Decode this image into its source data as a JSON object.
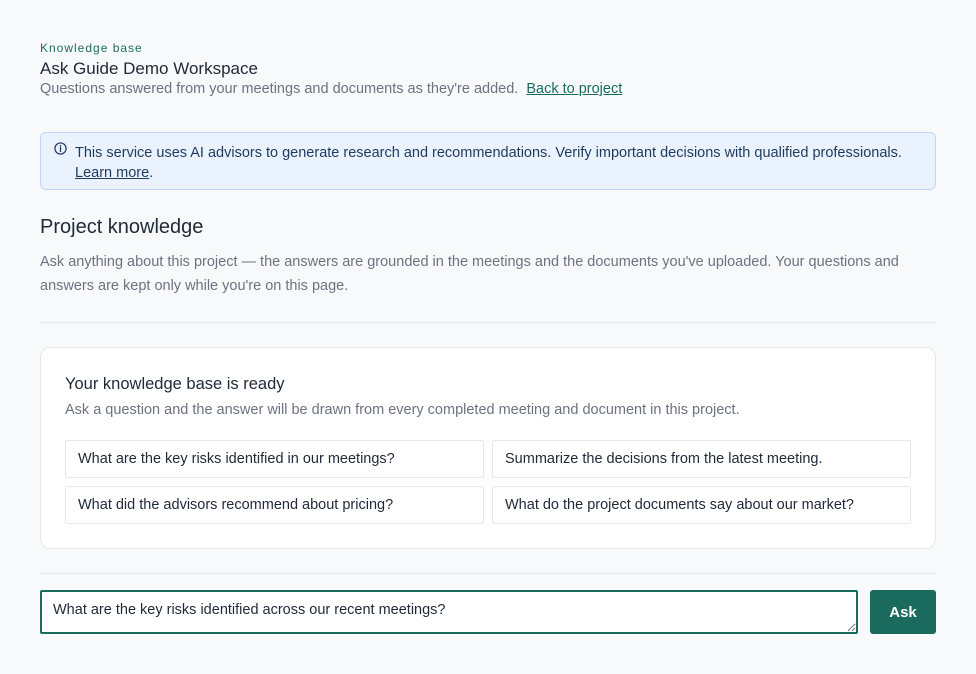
{
  "header": {
    "eyebrow": "Knowledge base",
    "workspace_title": "Ask Guide Demo Workspace",
    "subtitle": "Questions answered from your meetings and documents as they're added.",
    "back_link": "Back to project"
  },
  "notice": {
    "icon": "info-icon",
    "text": "This service uses AI advisors to generate research and recommendations. Verify important decisions with qualified professionals.",
    "link": "Learn more",
    "suffix": "."
  },
  "section": {
    "title": "Project knowledge",
    "description": "Ask anything about this project — the answers are grounded in the meetings and the documents you've uploaded. Your questions and answers are kept only while you're on this page."
  },
  "card": {
    "title": "Your knowledge base is ready",
    "description": "Ask a question and the answer will be drawn from every completed meeting and document in this project.",
    "suggestions": [
      "What are the key risks identified in our meetings?",
      "Summarize the decisions from the latest meeting.",
      "What did the advisors recommend about pricing?",
      "What do the project documents say about our market?"
    ]
  },
  "ask": {
    "input_value": "What are the key risks identified across our recent meetings?",
    "button_label": "Ask"
  },
  "colors": {
    "accent": "#1a6b5e",
    "notice_bg": "#eaf2fd",
    "notice_border": "#bfd6f6"
  }
}
